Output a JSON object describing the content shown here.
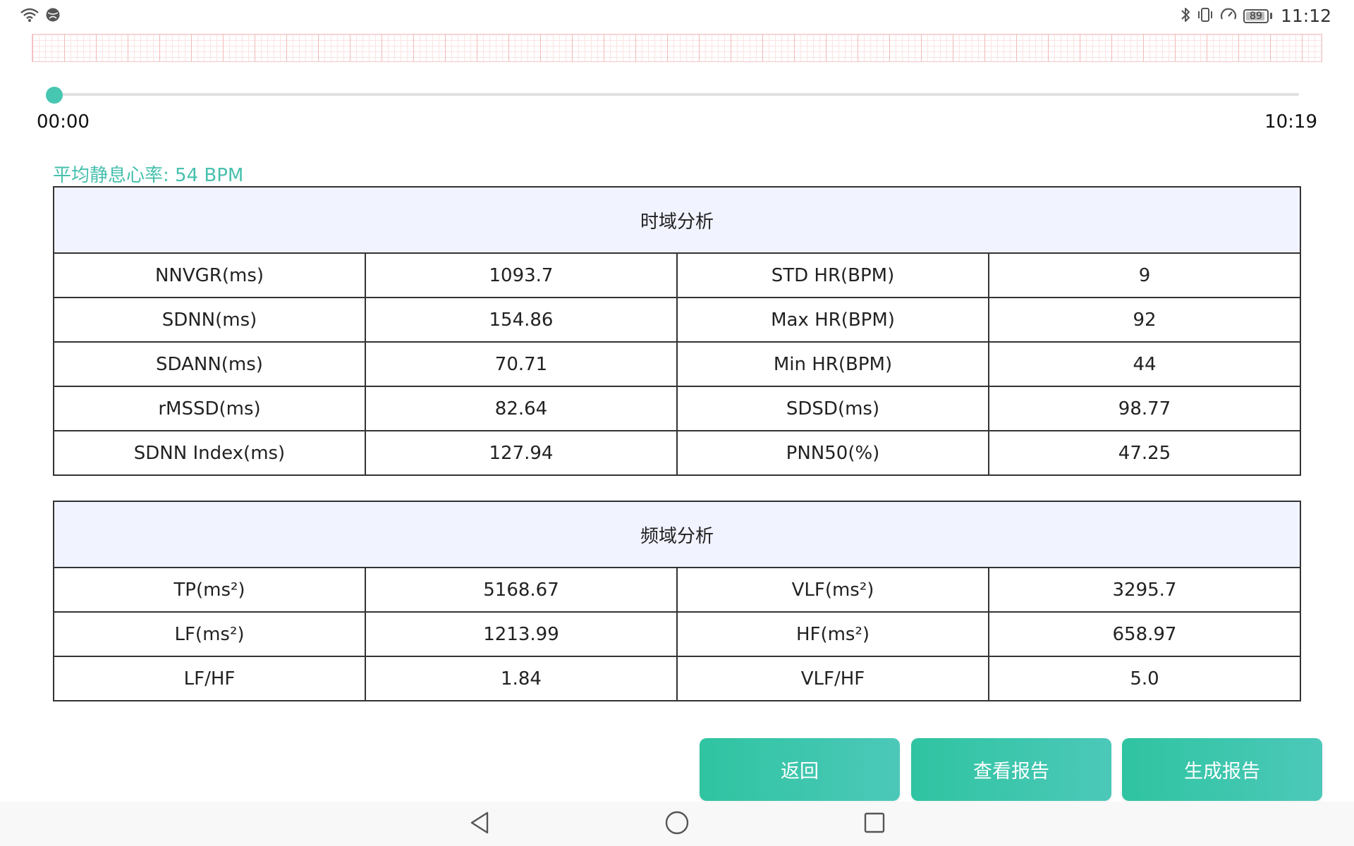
{
  "status_bar": {
    "time": "11:12",
    "battery": "89",
    "icons": [
      "wifi-icon",
      "vpn-globe-icon",
      "bluetooth-icon",
      "vibrate-icon",
      "data-saver-icon",
      "battery-icon"
    ]
  },
  "player": {
    "start_time": "00:00",
    "end_time": "10:19",
    "progress": 0
  },
  "resting_hr": {
    "text": "平均静息心率: 54 BPM"
  },
  "time_domain": {
    "title": "时域分析",
    "rows": [
      {
        "label1": "NNVGR(ms)",
        "value1": "1093.7",
        "label2": "STD HR(BPM)",
        "value2": "9"
      },
      {
        "label1": "SDNN(ms)",
        "value1": "154.86",
        "label2": "Max HR(BPM)",
        "value2": "92"
      },
      {
        "label1": "SDANN(ms)",
        "value1": "70.71",
        "label2": "Min HR(BPM)",
        "value2": "44"
      },
      {
        "label1": "rMSSD(ms)",
        "value1": "82.64",
        "label2": "SDSD(ms)",
        "value2": "98.77"
      },
      {
        "label1": "SDNN Index(ms)",
        "value1": "127.94",
        "label2": "PNN50(%)",
        "value2": "47.25"
      }
    ]
  },
  "freq_domain": {
    "title": "频域分析",
    "rows": [
      {
        "label1": "TP(ms²)",
        "value1": "5168.67",
        "label2": "VLF(ms²)",
        "value2": "3295.7"
      },
      {
        "label1": "LF(ms²)",
        "value1": "1213.99",
        "label2": "HF(ms²)",
        "value2": "658.97"
      },
      {
        "label1": "LF/HF",
        "value1": "1.84",
        "label2": "VLF/HF",
        "value2": "5.0"
      }
    ]
  },
  "buttons": {
    "back": "返回",
    "view_report": "查看报告",
    "generate_report": "生成报告"
  },
  "colors": {
    "accent": "#46c0ad",
    "button_start": "#2fc4a1",
    "button_end": "#4cc8b9",
    "table_header_bg": "#f1f3ff"
  }
}
